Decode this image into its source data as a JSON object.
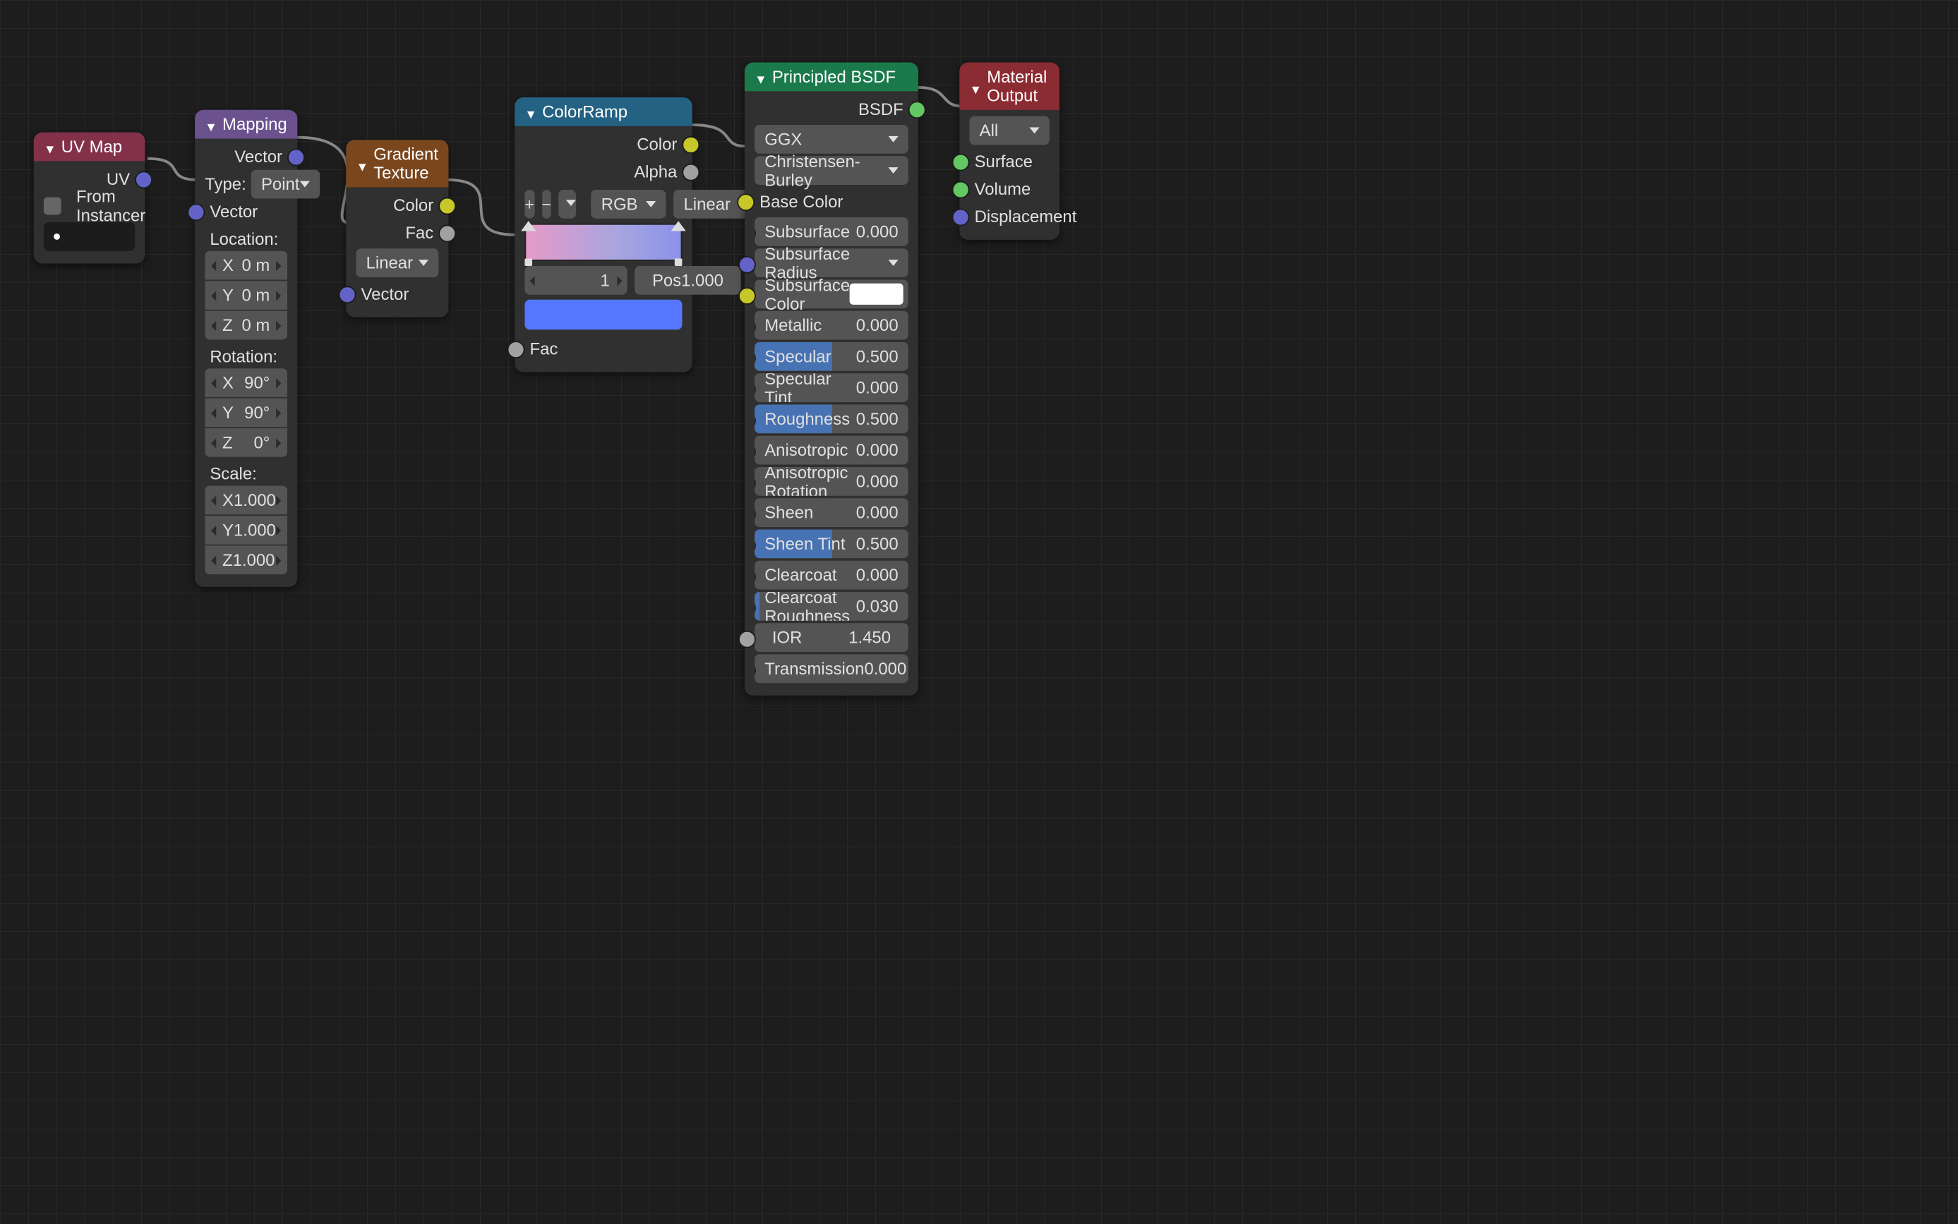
{
  "uvmap": {
    "title": "UV Map",
    "out_uv": "UV",
    "from_instancer": "From Instancer"
  },
  "mapping": {
    "title": "Mapping",
    "out_vector": "Vector",
    "type_label": "Type:",
    "type_value": "Point",
    "in_vector": "Vector",
    "location_label": "Location:",
    "location": {
      "x_l": "X",
      "x_v": "0 m",
      "y_l": "Y",
      "y_v": "0 m",
      "z_l": "Z",
      "z_v": "0 m"
    },
    "rotation_label": "Rotation:",
    "rotation": {
      "x_l": "X",
      "x_v": "90°",
      "y_l": "Y",
      "y_v": "90°",
      "z_l": "Z",
      "z_v": "0°"
    },
    "scale_label": "Scale:",
    "scale": {
      "x_l": "X",
      "x_v": "1.000",
      "y_l": "Y",
      "y_v": "1.000",
      "z_l": "Z",
      "z_v": "1.000"
    }
  },
  "gradient": {
    "title": "Gradient Texture",
    "out_color": "Color",
    "out_fac": "Fac",
    "type": "Linear",
    "in_vector": "Vector"
  },
  "colorramp": {
    "title": "ColorRamp",
    "out_color": "Color",
    "out_alpha": "Alpha",
    "mode": "RGB",
    "interp": "Linear",
    "stop_index": "1",
    "pos_label": "Pos",
    "pos_value": "1.000",
    "in_fac": "Fac"
  },
  "bsdf": {
    "title": "Principled BSDF",
    "out_bsdf": "BSDF",
    "distribution": "GGX",
    "subsurface_method": "Christensen-Burley",
    "base_color": "Base Color",
    "subsurface_l": "Subsurface",
    "subsurface_v": "0.000",
    "subsurface_radius": "Subsurface Radius",
    "subsurface_color": "Subsurface Color",
    "metallic_l": "Metallic",
    "metallic_v": "0.000",
    "specular_l": "Specular",
    "specular_v": "0.500",
    "specular_tint_l": "Specular Tint",
    "specular_tint_v": "0.000",
    "roughness_l": "Roughness",
    "roughness_v": "0.500",
    "anisotropic_l": "Anisotropic",
    "anisotropic_v": "0.000",
    "anisotropic_rot_l": "Anisotropic Rotation",
    "anisotropic_rot_v": "0.000",
    "sheen_l": "Sheen",
    "sheen_v": "0.000",
    "sheen_tint_l": "Sheen Tint",
    "sheen_tint_v": "0.500",
    "clearcoat_l": "Clearcoat",
    "clearcoat_v": "0.000",
    "clearcoat_rough_l": "Clearcoat Roughness",
    "clearcoat_rough_v": "0.030",
    "ior_l": "IOR",
    "ior_v": "1.450",
    "transmission_l": "Transmission",
    "transmission_v": "0.000"
  },
  "output": {
    "title": "Material Output",
    "target": "All",
    "surface": "Surface",
    "volume": "Volume",
    "displacement": "Displacement"
  }
}
